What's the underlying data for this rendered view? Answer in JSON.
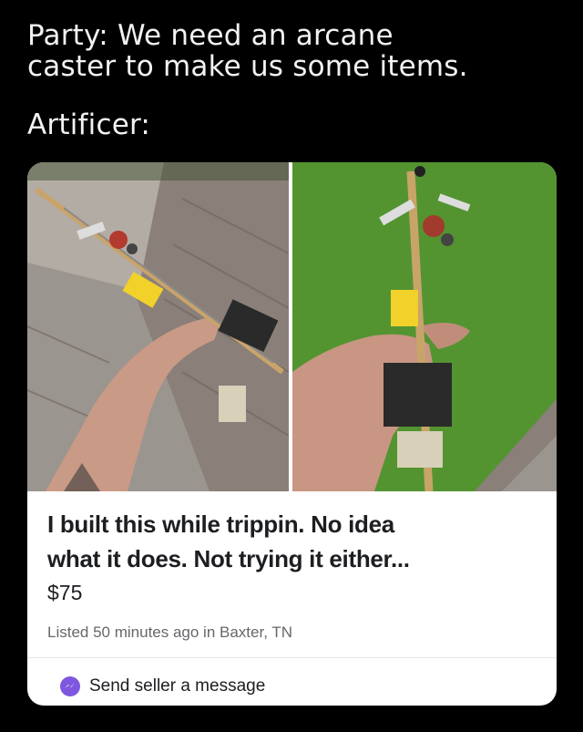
{
  "meme": {
    "caption_line_1": "Party: We need an arcane",
    "caption_line_2": "caster to make us some items.",
    "caption_line_3": "Artificer:"
  },
  "listing": {
    "title_line_1": "I built this while trippin. No idea",
    "title_line_2": "what it does. Not trying it either...",
    "price": "$75",
    "meta": "Listed 50 minutes ago in Baxter, TN",
    "message_button_label": "Send seller a message",
    "messenger_icon": "messenger-icon",
    "accent_color": "#7e57e0"
  }
}
